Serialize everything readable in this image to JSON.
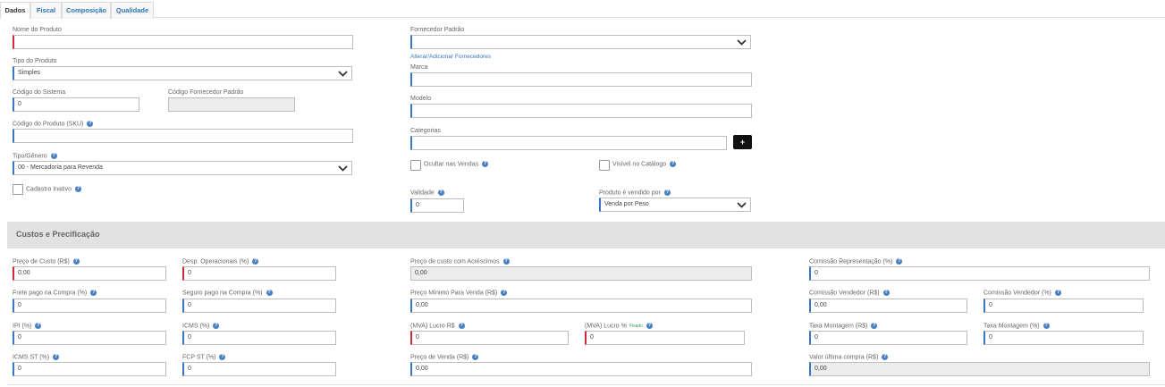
{
  "tabs": [
    "Dados",
    "Fiscal",
    "Composição",
    "Qualidade"
  ],
  "icons": {
    "help": "help-circle-icon",
    "dropdown": "chevron-down-icon"
  },
  "colors": {
    "accent": "#3a76c3",
    "required": "#d0283c",
    "section_bg": "#e2e2e2"
  },
  "product": {
    "nome_label": "Nome do Produto",
    "nome_value": "",
    "tipo_label": "Tipo do Produto",
    "tipo_value": "Simples",
    "codigo_sistema_label": "Código do Sistema",
    "codigo_sistema_value": "0",
    "codigo_fornecedor_label": "Código Fornecedor Padrão",
    "codigo_fornecedor_value": "",
    "sku_label": "Código do Produto (SKU)",
    "sku_value": "",
    "genero_label": "Tipo/Gênero",
    "genero_value": "00 - Mercadoria para Revenda",
    "inativo_label": "Cadastro Inativo",
    "fornecedor_label": "Fornecedor Padrão",
    "fornecedor_value": "",
    "alterar_link": "Alterar/Adicionar Fornecedores",
    "marca_label": "Marca",
    "marca_value": "",
    "modelo_label": "Modelo",
    "modelo_value": "",
    "categorias_label": "Categorias",
    "categorias_value": "",
    "add_categoria": "+",
    "ocultar_label": "Ocultar nas Vendas",
    "visivel_label": "Visível no Catálogo",
    "validade_label": "Validade",
    "validade_value": "0",
    "vendido_label": "Produto é vendido por",
    "vendido_value": "Venda por Peso"
  },
  "costs": {
    "section_title": "Custos e Precificação",
    "preco_custo_label": "Preço de Custo (R$)",
    "preco_custo_value": "0,00",
    "desp_label": "Desp. Operacionais (%)",
    "desp_value": "0",
    "custo_acresc_label": "Preço de custo com Acréscimos",
    "custo_acresc_value": "0,00",
    "comissao_rep_label": "Comissão Representação (%)",
    "comissao_rep_value": "0",
    "frete_label": "Frete pago na Compra (%)",
    "frete_value": "0",
    "seguro_label": "Seguro pago na Compra (%)",
    "seguro_value": "0",
    "preco_min_label": "Preço Mínimo Para Venda (R$)",
    "preco_min_value": "0,00",
    "comissao_vend_rs_label": "Comissão Vendedor (R$)",
    "comissao_vend_rs_value": "0,00",
    "comissao_vend_pct_label": "Comissão Vendedor (%)",
    "comissao_vend_pct_value": "0",
    "ipi_label": "IPI (%)",
    "ipi_value": "0",
    "icms_label": "ICMS (%)",
    "icms_value": "0",
    "mva_rs_label": "(MVA) Lucro R$",
    "mva_rs_value": "0",
    "mva_pct_label": "(MVA) Lucro %",
    "mva_pct_note": "Fixado",
    "mva_pct_value": "0",
    "taxa_rs_label": "Taxa Montagem (R$)",
    "taxa_rs_value": "0",
    "taxa_pct_label": "Taxa Montagem (%)",
    "taxa_pct_value": "0",
    "icms_st_label": "ICMS ST (%)",
    "icms_st_value": "0",
    "fcp_label": "FCP ST (%)",
    "fcp_value": "0",
    "preco_venda_label": "Preço de Venda (R$)",
    "preco_venda_value": "0,00",
    "valor_ultima_label": "Valor última compra (R$)",
    "valor_ultima_value": "0,00"
  }
}
